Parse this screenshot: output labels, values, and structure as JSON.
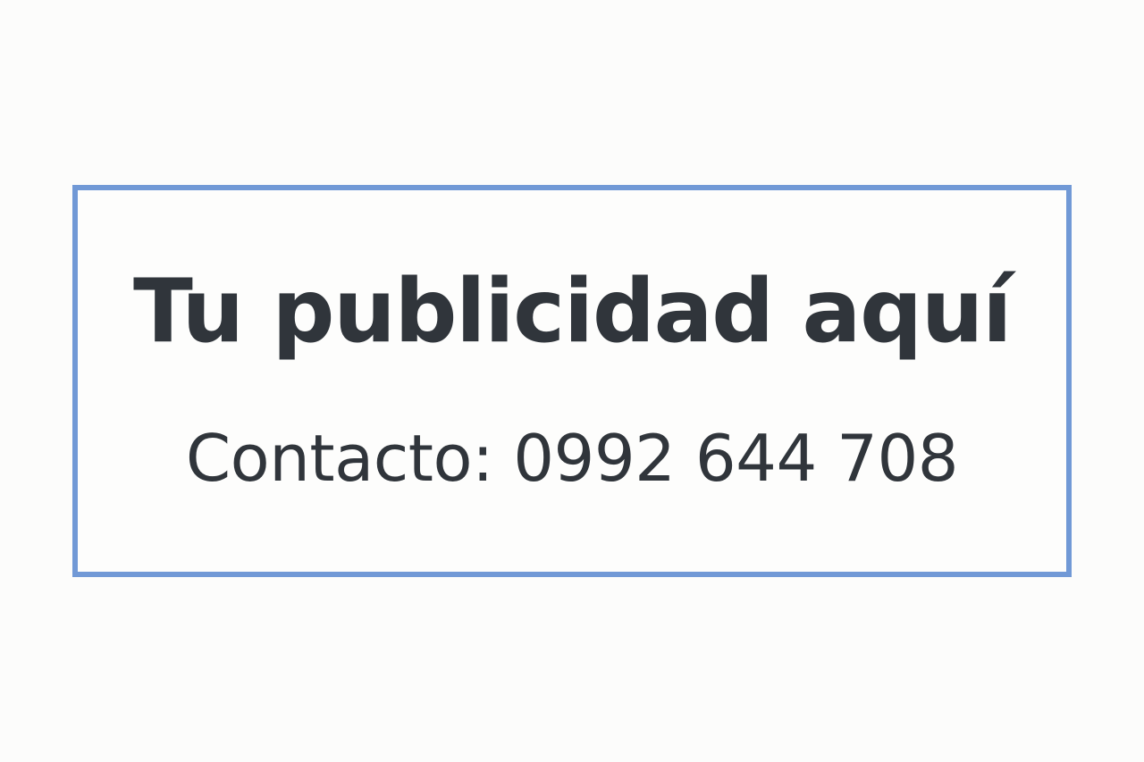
{
  "ad": {
    "headline": "Tu publicidad aquí",
    "contact": "Contacto: 0992 644 708"
  },
  "colors": {
    "background": "#fcfcfb",
    "border": "#7199d6",
    "text": "#30353b"
  }
}
